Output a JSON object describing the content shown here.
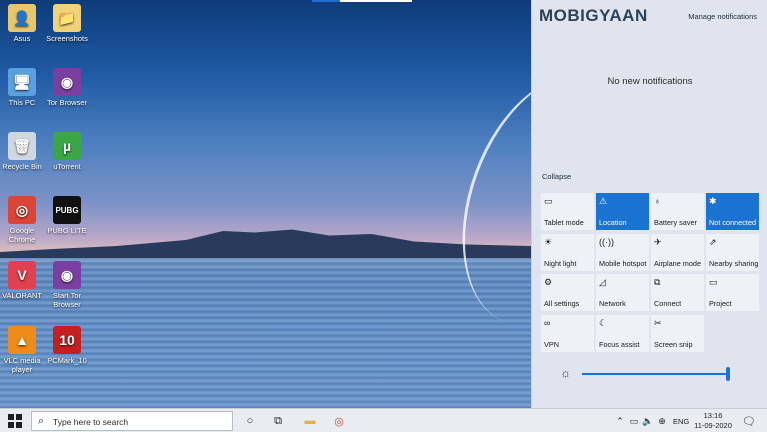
{
  "desktop": {
    "icons": [
      {
        "label": "Asus",
        "glyph": "👤",
        "color": "#e8c66a"
      },
      {
        "label": "Screenshots",
        "glyph": "📁",
        "color": "#f0d27a"
      },
      {
        "label": "This PC",
        "glyph": "🖥",
        "color": "#5aa0e0"
      },
      {
        "label": "Tor Browser",
        "glyph": "◉",
        "color": "#7a3fa0"
      },
      {
        "label": "Recycle Bin",
        "glyph": "🗑",
        "color": "#cfd8e0"
      },
      {
        "label": "uTorrent",
        "glyph": "µ",
        "color": "#3aa645"
      },
      {
        "label": "Google Chrome",
        "glyph": "◎",
        "color": "#db4437"
      },
      {
        "label": "PUBG LITE",
        "glyph": "PUBG",
        "color": "#111111"
      },
      {
        "label": "VALORANT",
        "glyph": "V",
        "color": "#e04050"
      },
      {
        "label": "Start Tor Browser",
        "glyph": "◉",
        "color": "#7a3fa0"
      },
      {
        "label": "VLC media player",
        "glyph": "▲",
        "color": "#f08a18"
      },
      {
        "label": "PCMark_10",
        "glyph": "10",
        "color": "#c42020"
      }
    ]
  },
  "action_center": {
    "logo": "MOBIGYAAN",
    "manage_label": "Manage notifications",
    "empty_text": "No new notifications",
    "collapse_label": "Collapse",
    "tiles": [
      {
        "label": "Tablet mode",
        "icon": "▭",
        "active": false
      },
      {
        "label": "Location",
        "icon": "⚠",
        "active": true
      },
      {
        "label": "Battery saver",
        "icon": "♁",
        "active": false
      },
      {
        "label": "Not connected",
        "icon": "✱",
        "active": true
      },
      {
        "label": "Night light",
        "icon": "☀",
        "active": false
      },
      {
        "label": "Mobile hotspot",
        "icon": "((·))",
        "active": false
      },
      {
        "label": "Airplane mode",
        "icon": "✈",
        "active": false
      },
      {
        "label": "Nearby sharing",
        "icon": "⇗",
        "active": false
      },
      {
        "label": "All settings",
        "icon": "⚙",
        "active": false
      },
      {
        "label": "Network",
        "icon": "◿",
        "active": false
      },
      {
        "label": "Connect",
        "icon": "⧉",
        "active": false
      },
      {
        "label": "Project",
        "icon": "▭",
        "active": false
      },
      {
        "label": "VPN",
        "icon": "∞",
        "active": false
      },
      {
        "label": "Focus assist",
        "icon": "☾",
        "active": false
      },
      {
        "label": "Screen snip",
        "icon": "✂",
        "active": false
      }
    ],
    "brightness": {
      "icon": "☼",
      "value": 0.98
    }
  },
  "taskbar": {
    "search_placeholder": "Type here to search",
    "language": "ENG",
    "time": "13:16",
    "date": "11-09-2020"
  }
}
